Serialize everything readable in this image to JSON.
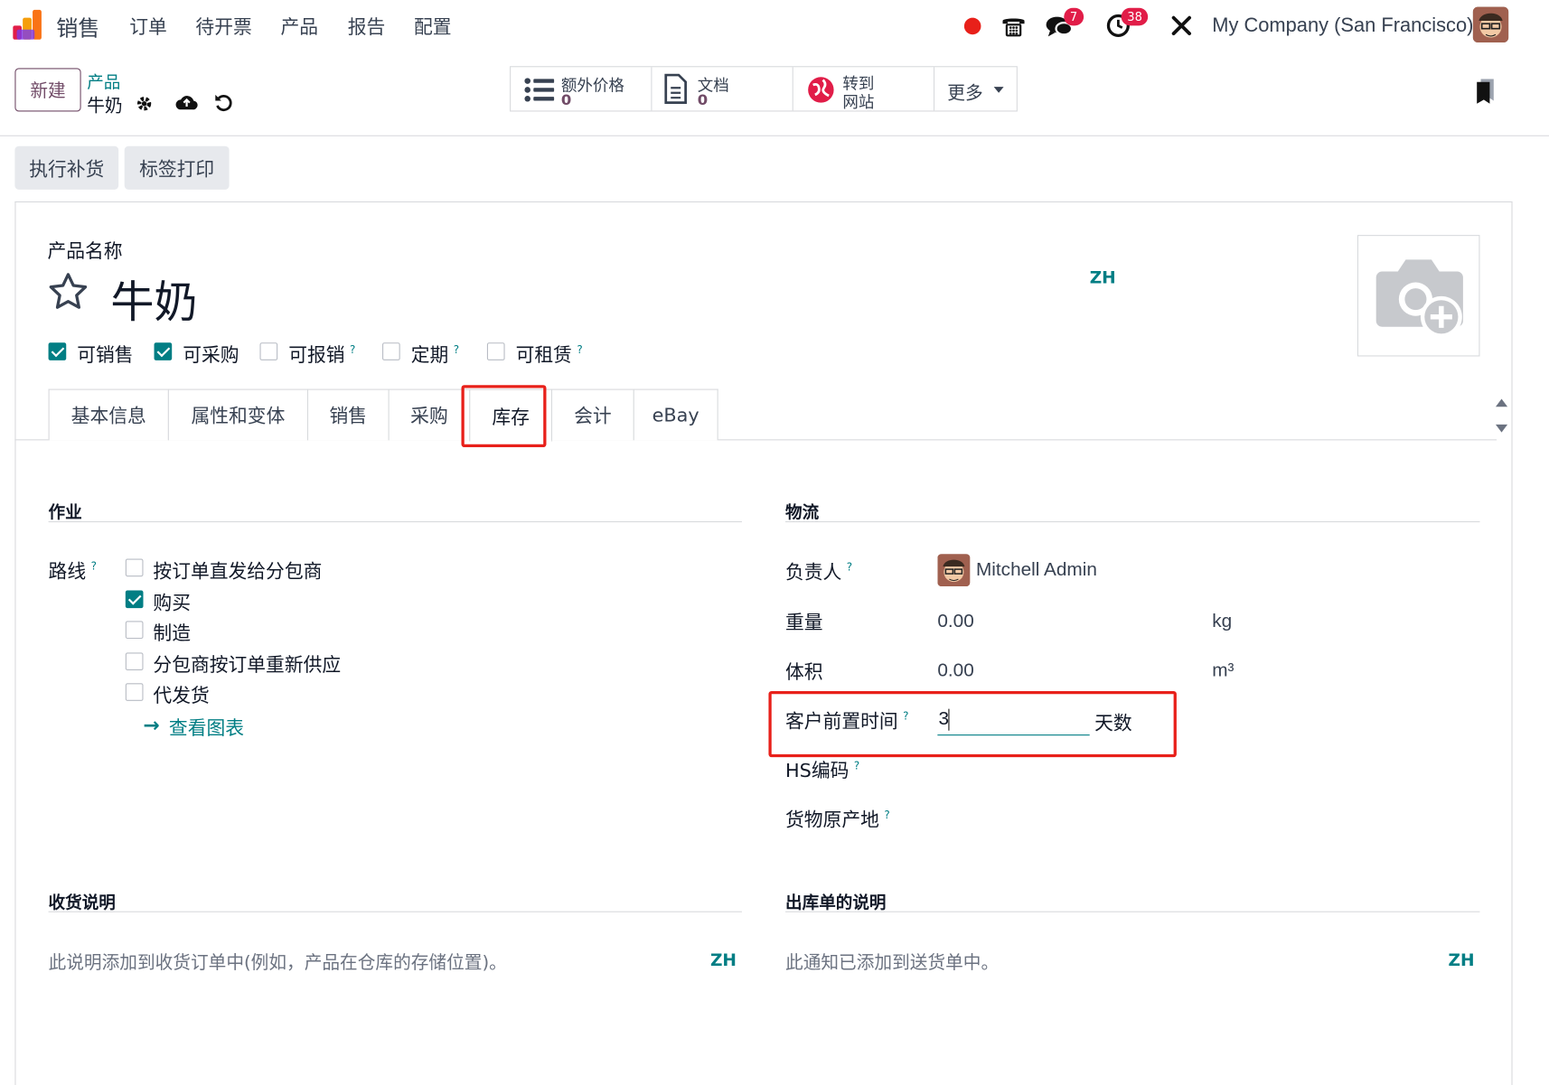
{
  "topnav": {
    "app_name": "销售",
    "menu": [
      "订单",
      "待开票",
      "产品",
      "报告",
      "配置"
    ],
    "messages_badge": "7",
    "activities_badge": "38",
    "company": "My Company (San Francisco)"
  },
  "control_panel": {
    "new_button": "新建",
    "breadcrumb_parent": "产品",
    "record_name": "牛奶",
    "smart_buttons": [
      {
        "label": "额外价格",
        "value": "0"
      },
      {
        "label": "文档",
        "value": "0"
      },
      {
        "label_line1": "转到",
        "label_line2": "网站"
      }
    ],
    "more_label": "更多"
  },
  "actions": {
    "replenish": "执行补货",
    "print_labels": "标签打印"
  },
  "form": {
    "name_label": "产品名称",
    "product_name": "牛奶",
    "lang_tag": "ZH",
    "checkboxes": [
      {
        "label": "可销售",
        "checked": true
      },
      {
        "label": "可采购",
        "checked": true
      },
      {
        "label": "可报销",
        "checked": false
      },
      {
        "label": "定期",
        "checked": false
      },
      {
        "label": "可租赁",
        "checked": false
      }
    ],
    "tabs": [
      "基本信息",
      "属性和变体",
      "销售",
      "采购",
      "库存",
      "会计",
      "eBay"
    ],
    "active_tab": "库存"
  },
  "operations": {
    "title": "作业",
    "routes_label": "路线",
    "routes": [
      {
        "label": "按订单直发给分包商",
        "checked": false
      },
      {
        "label": "购买",
        "checked": true
      },
      {
        "label": "制造",
        "checked": false
      },
      {
        "label": "分包商按订单重新供应",
        "checked": false
      },
      {
        "label": "代发货",
        "checked": false
      }
    ],
    "view_diagram": "查看图表"
  },
  "logistics": {
    "title": "物流",
    "responsible_label": "负责人",
    "responsible_value": "Mitchell Admin",
    "weight_label": "重量",
    "weight_value": "0.00",
    "weight_unit": "kg",
    "volume_label": "体积",
    "volume_value": "0.00",
    "volume_unit": "m³",
    "lead_time_label": "客户前置时间",
    "lead_time_value": "3",
    "lead_time_unit": "天数",
    "hs_code_label": "HS编码",
    "origin_label": "货物原产地"
  },
  "receipt": {
    "title": "收货说明",
    "text": "此说明添加到收货订单中(例如，产品在仓库的存储位置)。",
    "lang_tag": "ZH"
  },
  "delivery": {
    "title": "出库单的说明",
    "text": "此通知已添加到送货单中。",
    "lang_tag": "ZH"
  },
  "colors": {
    "brand": "#714b67",
    "accent": "#017e84",
    "highlight": "#e8201a"
  }
}
